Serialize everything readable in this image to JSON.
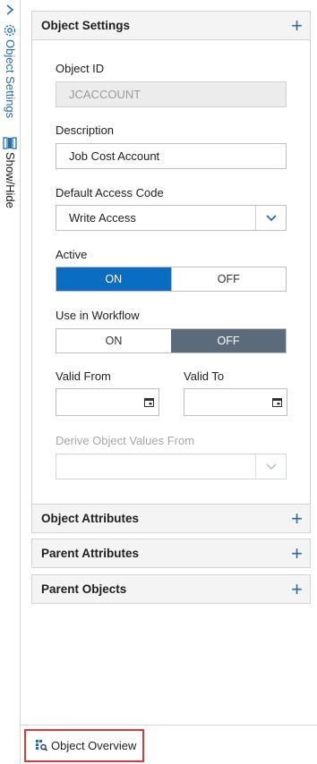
{
  "rail": {
    "object_settings_label": "Object Settings",
    "show_hide_label": "Show/Hide"
  },
  "sections": {
    "object_settings": "Object Settings",
    "object_attributes": "Object Attributes",
    "parent_attributes": "Parent Attributes",
    "parent_objects": "Parent Objects"
  },
  "form": {
    "object_id_label": "Object ID",
    "object_id_value": "JCACCOUNT",
    "description_label": "Description",
    "description_value": "Job Cost Account",
    "access_code_label": "Default Access Code",
    "access_code_value": "Write Access",
    "active_label": "Active",
    "active_on": "ON",
    "active_off": "OFF",
    "workflow_label": "Use in Workflow",
    "workflow_on": "ON",
    "workflow_off": "OFF",
    "valid_from_label": "Valid From",
    "valid_to_label": "Valid To",
    "derive_label": "Derive Object Values From"
  },
  "footer": {
    "overview_label": "Object Overview"
  },
  "colors": {
    "accent": "#1f6fb2",
    "toggle_on": "#0a6cc2",
    "toggle_off_active": "#5b6b7b",
    "highlight": "#d63b3b"
  }
}
